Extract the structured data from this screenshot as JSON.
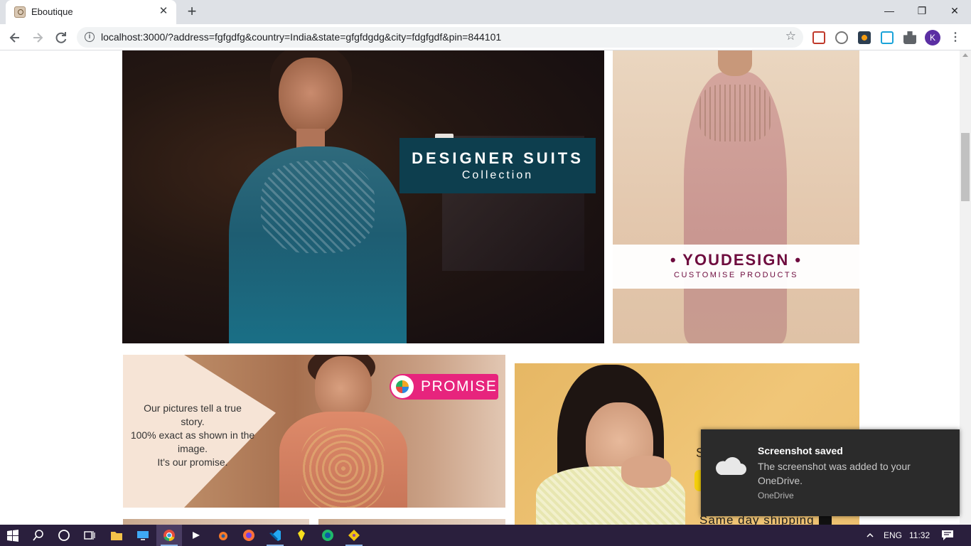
{
  "browser": {
    "tab_title": "Eboutique",
    "tab_close": "✕",
    "new_tab": "+",
    "url": "localhost:3000/?address=fgfgdfg&country=India&state=gfgfdgdg&city=fdgfgdf&pin=844101",
    "profile_initial": "K",
    "window_controls": {
      "minimize": "—",
      "restore": "❐",
      "close": "✕"
    }
  },
  "page": {
    "suits_banner": {
      "title": "DESIGNER SUITS",
      "subtitle": "Collection"
    },
    "youdesign_banner": {
      "title": "• YOUDESIGN •",
      "subtitle": "CUSTOMISE PRODUCTS"
    },
    "promise_banner": {
      "badge": "PROMISE",
      "line1": "Our pictures tell a true",
      "line2": "story.",
      "line3": "100% exact as shown in the",
      "line4": "image.",
      "line5": "It's our promise."
    },
    "shipping_banner": {
      "partial_letter": "S",
      "shipping_text": "Same day shipping"
    }
  },
  "toast": {
    "title": "Screenshot saved",
    "message": "The screenshot was added to your OneDrive.",
    "source": "OneDrive"
  },
  "taskbar": {
    "language": "ENG",
    "time": "11:32",
    "apps": [
      "start-icon",
      "search-icon",
      "cortana-icon",
      "task-view-icon",
      "file-explorer-icon",
      "remote-desktop-icon",
      "chrome-icon",
      "media-player-icon",
      "blender-icon",
      "firefox-icon",
      "vscode-icon",
      "kotlin-icon",
      "edge-icon",
      "git-icon"
    ]
  },
  "colors": {
    "suits_label_bg": "#0d3e4e",
    "youdesign_text": "#6e0b3e",
    "promise_badge": "#e7247d",
    "taskbar_bg": "#2a1f3d",
    "avatar_bg": "#5b2fa3"
  }
}
